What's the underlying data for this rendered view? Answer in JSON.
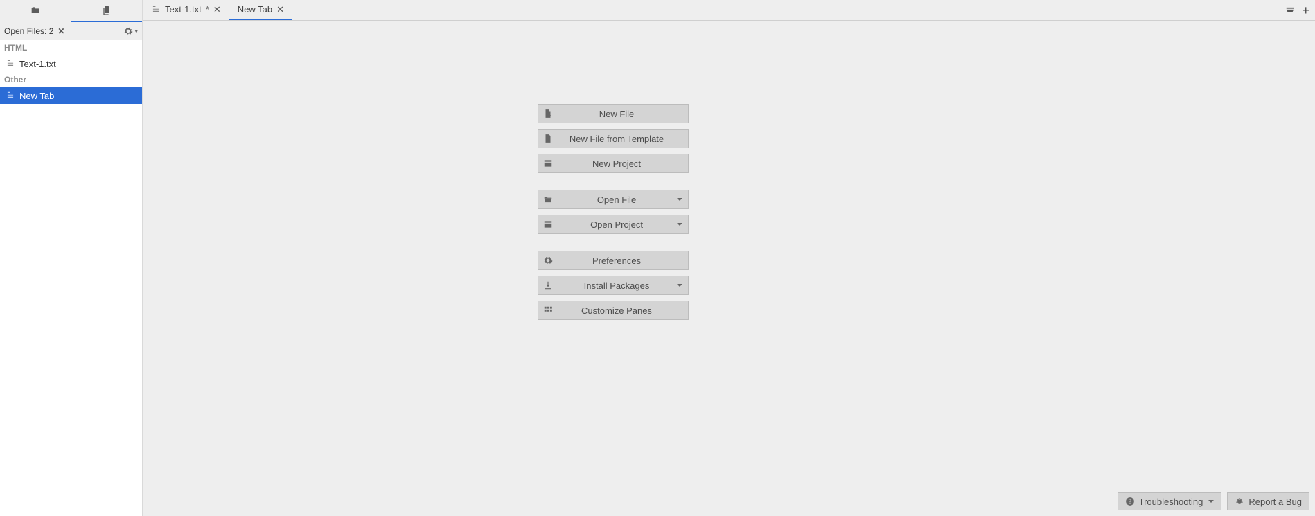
{
  "sidebar": {
    "header": {
      "title": "Open Files: 2"
    },
    "sections": [
      {
        "label": "HTML",
        "items": [
          {
            "label": "Text-1.txt",
            "selected": false
          }
        ]
      },
      {
        "label": "Other",
        "items": [
          {
            "label": "New Tab",
            "selected": true
          }
        ]
      }
    ]
  },
  "tabs": [
    {
      "label": "Text-1.txt",
      "dirty": true,
      "active": false,
      "hasIcon": true
    },
    {
      "label": "New Tab",
      "dirty": false,
      "active": true,
      "hasIcon": false
    }
  ],
  "start": {
    "groups": [
      [
        {
          "label": "New File",
          "icon": "file-new",
          "dropdown": false
        },
        {
          "label": "New File from Template",
          "icon": "file-lines",
          "dropdown": false
        },
        {
          "label": "New Project",
          "icon": "project",
          "dropdown": false
        }
      ],
      [
        {
          "label": "Open File",
          "icon": "folder-open",
          "dropdown": true
        },
        {
          "label": "Open Project",
          "icon": "project",
          "dropdown": true
        }
      ],
      [
        {
          "label": "Preferences",
          "icon": "gear",
          "dropdown": false
        },
        {
          "label": "Install Packages",
          "icon": "download",
          "dropdown": true
        },
        {
          "label": "Customize Panes",
          "icon": "grid",
          "dropdown": false
        }
      ]
    ]
  },
  "footer": {
    "troubleshooting": "Troubleshooting",
    "report": "Report a Bug"
  }
}
